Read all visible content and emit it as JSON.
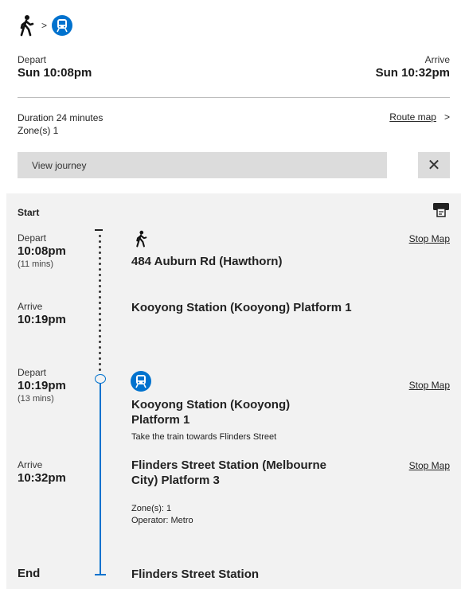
{
  "summary": {
    "depart_label": "Depart",
    "depart_time": "Sun 10:08pm",
    "arrive_label": "Arrive",
    "arrive_time": "Sun 10:32pm",
    "duration": "Duration 24 minutes",
    "zones": "Zone(s) 1",
    "route_map_link": "Route map",
    "route_map_chevron": ">",
    "view_journey": "View journey",
    "close_symbol": "✕",
    "mode_chevron": ">"
  },
  "icons": {
    "walk": "walk-icon",
    "train": "train-icon",
    "print": "print-icon",
    "close": "close-icon",
    "chevron": "chevron-right-icon"
  },
  "colors": {
    "train_blue": "#0072ce",
    "panel_bg": "#f2f2f2",
    "bar_bg": "#dcdcdc"
  },
  "journey": {
    "start_label": "Start",
    "end_label": "End",
    "end_place": "Flinders Street Station",
    "stop_map_label": "Stop Map",
    "leg1": {
      "depart_label": "Depart",
      "depart_time": "10:08pm",
      "duration": "(11 mins)",
      "from": "484 Auburn Rd (Hawthorn)",
      "arrive_label": "Arrive",
      "arrive_time": "10:19pm",
      "to": "Kooyong Station (Kooyong) Platform 1"
    },
    "leg2": {
      "depart_label": "Depart",
      "depart_time": "10:19pm",
      "duration": "(13 mins)",
      "from_line1": "Kooyong Station (Kooyong)",
      "from_line2": "Platform 1",
      "instruction": "Take the train towards Flinders Street",
      "arrive_label": "Arrive",
      "arrive_time": "10:32pm",
      "to_line1": "Flinders Street Station (Melbourne",
      "to_line2": "City) Platform 3",
      "zones": "Zone(s): 1",
      "operator": "Operator: Metro"
    }
  }
}
